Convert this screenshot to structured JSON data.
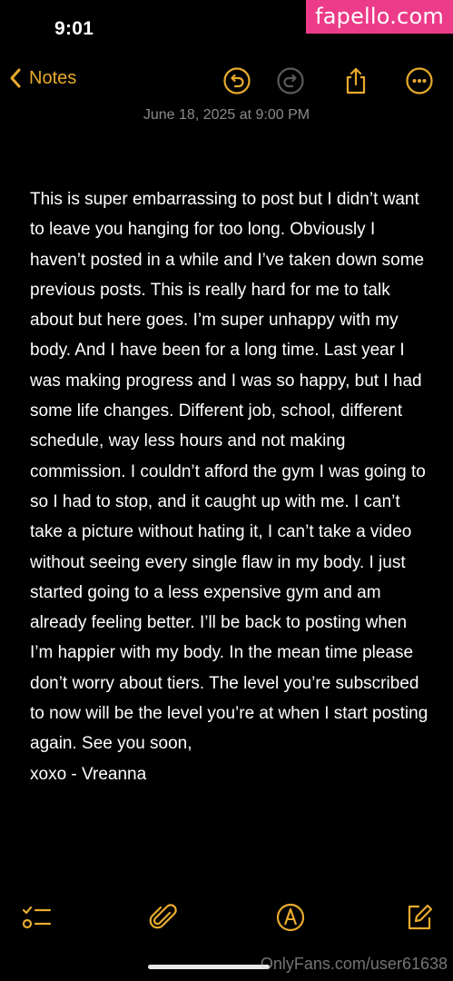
{
  "status_bar": {
    "time": "9:01"
  },
  "watermark_top": "fapello.com",
  "nav": {
    "back_label": "Notes",
    "accent_color": "#e8ab2c",
    "icons": [
      "undo-icon",
      "redo-icon",
      "share-icon",
      "more-icon"
    ]
  },
  "note": {
    "date": "June 18, 2025 at 9:00 PM",
    "body": "This is super embarrassing to post but I didn’t want to leave you hanging for too long. Obviously I haven’t posted in a while and I’ve taken down some previous posts. This is really hard for me to talk about but here goes. I’m super unhappy with my body. And I have been for a long time. Last year I was making progress and I was so happy, but I had some life changes. Different job, school, different schedule, way less hours and not making commission. I couldn’t afford the gym I was going to so I had to stop, and it caught up with me. I can’t take a picture without hating it, I can’t take a video without seeing every single flaw in my body. I just started going to a less expensive gym and am already feeling better. I’ll be back to posting when I’m happier with my body. In the mean time please don’t worry about tiers. The level you’re subscribed to now will be the level you’re at when I start posting again. See you soon,\nxoxo - Vreanna"
  },
  "toolbar": {
    "icons": [
      "checklist-icon",
      "attachment-icon",
      "markup-icon",
      "compose-icon"
    ]
  },
  "watermark_bottom": "OnlyFans.com/user61638"
}
